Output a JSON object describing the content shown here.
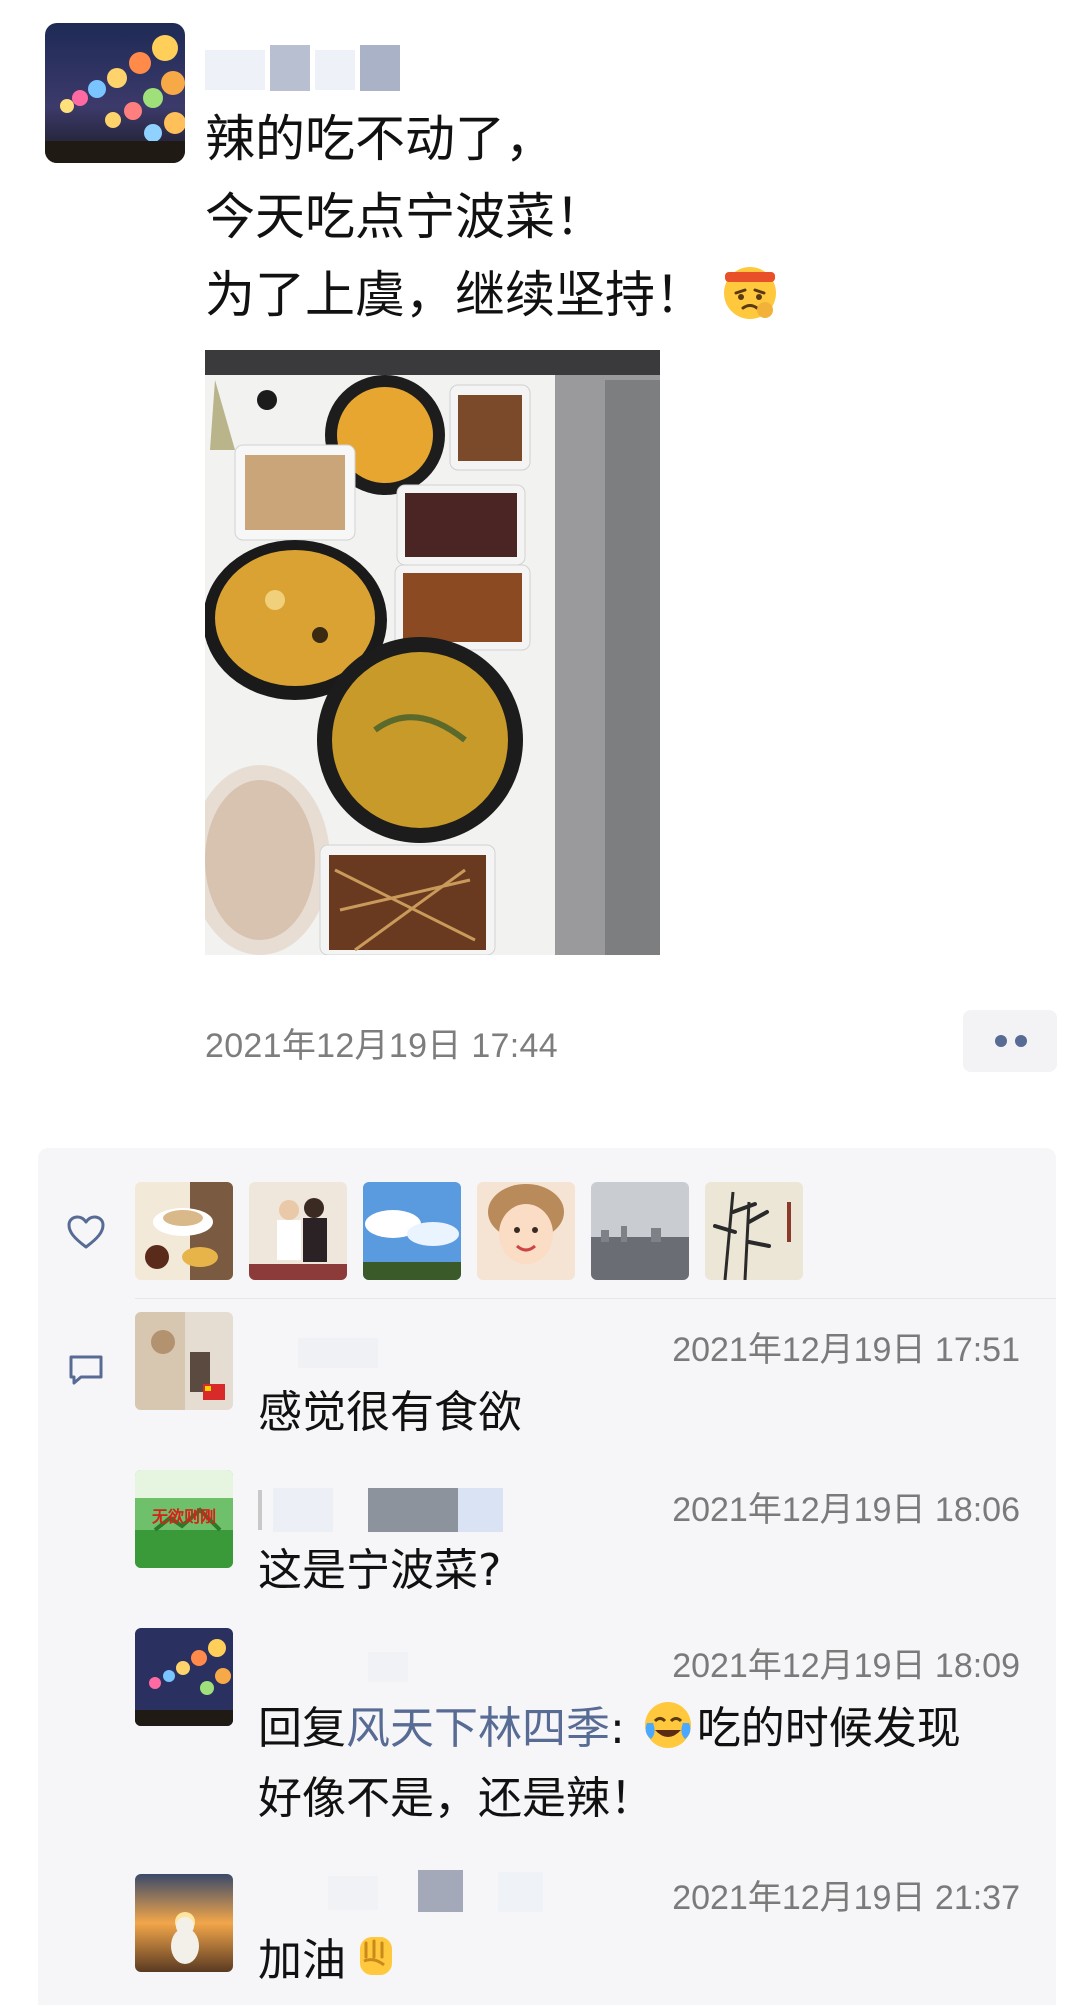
{
  "post": {
    "lines": [
      "辣的吃不动了，",
      "今天吃点宁波菜！",
      "为了上虞，继续坚持！"
    ],
    "emoji": "determined-headband-emoji",
    "timestamp": "2021年12月19日 17:44",
    "more_icon": "more-dots-icon"
  },
  "interactions": {
    "like_icon": "heart-outline-icon",
    "comment_icon": "comment-bubble-icon",
    "likers": [
      "coffee-cup-avatar",
      "family-photo-avatar",
      "sky-clouds-avatar",
      "child-smile-avatar",
      "city-skyline-avatar",
      "bamboo-painting-avatar"
    ]
  },
  "comments": [
    {
      "time": "2021年12月19日 17:51",
      "text": "感觉很有食欲",
      "avatar": "shop-interior-avatar"
    },
    {
      "time": "2021年12月19日 18:06",
      "text": "这是宁波菜?",
      "avatar": "green-sign-avatar",
      "avatar_text": "无欲则刚"
    },
    {
      "time": "2021年12月19日 18:09",
      "reply_prefix": "回复",
      "reply_to": "风天下林四季",
      "colon": ": ",
      "emoji": "tears-of-joy-emoji",
      "text_line1": "吃的时候发现",
      "text_line2": "好像不是，还是辣！",
      "avatar": "lantern-night-avatar"
    },
    {
      "time": "2021年12月19日 21:37",
      "text": "加油",
      "emoji": "raised-fist-emoji",
      "avatar": "sunset-dog-avatar"
    }
  ],
  "colors": {
    "link": "#576b95",
    "timestamp": "#7d7d7d",
    "panel_bg": "#f6f6f8"
  }
}
